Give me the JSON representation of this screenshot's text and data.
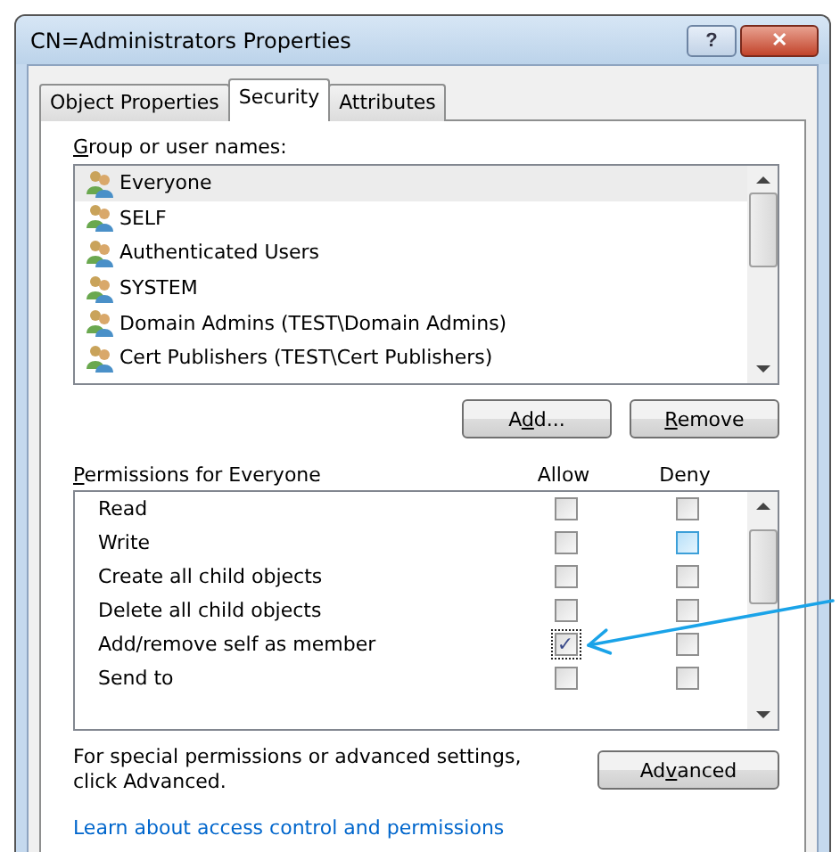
{
  "window": {
    "title": "CN=Administrators Properties",
    "buttons": [
      "?",
      "✕"
    ]
  },
  "tabs": [
    {
      "label": "Object Properties",
      "selected": false
    },
    {
      "label": "Security",
      "selected": true
    },
    {
      "label": "Attributes",
      "selected": false
    }
  ],
  "group_label": {
    "accel": "G",
    "rest": "roup or user names:"
  },
  "users": [
    {
      "name": "Everyone",
      "selected": true
    },
    {
      "name": "SELF",
      "selected": false
    },
    {
      "name": "Authenticated Users",
      "selected": false
    },
    {
      "name": "SYSTEM",
      "selected": false
    },
    {
      "name": "Domain Admins (TEST\\Domain Admins)",
      "selected": false
    },
    {
      "name": "Cert Publishers (TEST\\Cert Publishers)",
      "selected": false
    }
  ],
  "user_buttons": [
    {
      "before": "A",
      "accel": "d",
      "after": "d..."
    },
    {
      "accel": "R",
      "after": "emove"
    }
  ],
  "permissions_label": {
    "accel": "P",
    "rest": "ermissions for Everyone"
  },
  "columns": [
    "Allow",
    "Deny"
  ],
  "permissions": [
    {
      "name": "Read",
      "allow": {
        "checked": false,
        "highlighted": false,
        "focused": false
      },
      "deny": {
        "checked": false,
        "highlighted": false,
        "focused": false
      }
    },
    {
      "name": "Write",
      "allow": {
        "checked": false,
        "highlighted": false,
        "focused": false
      },
      "deny": {
        "checked": false,
        "highlighted": true,
        "focused": false
      }
    },
    {
      "name": "Create all child objects",
      "allow": {
        "checked": false,
        "highlighted": false,
        "focused": false
      },
      "deny": {
        "checked": false,
        "highlighted": false,
        "focused": false
      }
    },
    {
      "name": "Delete all child objects",
      "allow": {
        "checked": false,
        "highlighted": false,
        "focused": false
      },
      "deny": {
        "checked": false,
        "highlighted": false,
        "focused": false
      }
    },
    {
      "name": "Add/remove self as member",
      "allow": {
        "checked": true,
        "highlighted": false,
        "focused": true
      },
      "deny": {
        "checked": false,
        "highlighted": false,
        "focused": false
      }
    },
    {
      "name": "Send to",
      "allow": {
        "checked": false,
        "highlighted": false,
        "focused": false
      },
      "deny": {
        "checked": false,
        "highlighted": false,
        "focused": false
      }
    }
  ],
  "advanced_text": "For special permissions or advanced settings, click Advanced.",
  "advanced_button": {
    "before": "Ad",
    "accel": "v",
    "after": "anced"
  },
  "check_mark": "✓",
  "link": "Learn about access control and permissions"
}
